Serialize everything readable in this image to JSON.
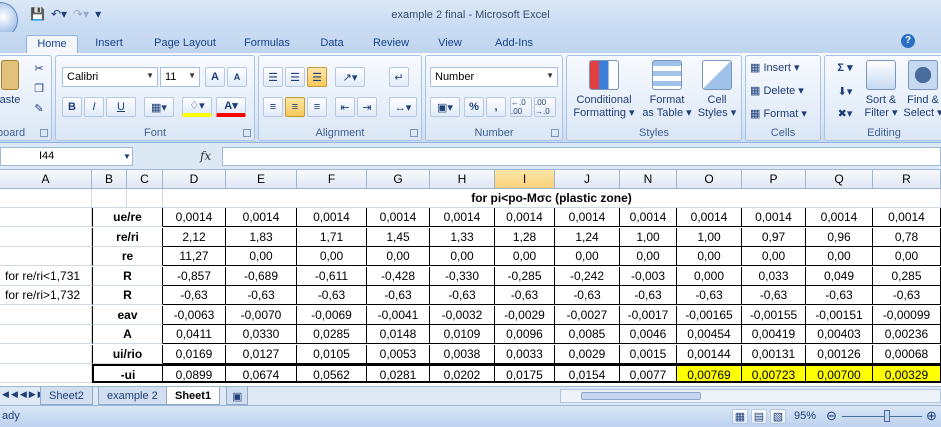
{
  "window": {
    "title": "example 2 final - Microsoft Excel"
  },
  "ribbon_tabs": [
    "Home",
    "Insert",
    "Page Layout",
    "Formulas",
    "Data",
    "Review",
    "View",
    "Add-Ins"
  ],
  "clipboard": {
    "paste": "aste",
    "label": "board"
  },
  "font": {
    "name": "Calibri",
    "size": "11",
    "bold": "B",
    "italic": "I",
    "underline": "U",
    "grow": "A",
    "shrink": "A",
    "color_letter": "A",
    "label": "Font"
  },
  "alignment": {
    "label": "Alignment"
  },
  "number": {
    "format": "Number",
    "percent": "%",
    "comma": ",",
    "inc": "←.0 .00",
    "dec": ".00 →.0",
    "label": "Number"
  },
  "styles": {
    "conditional": [
      "Conditional",
      "Formatting ▾"
    ],
    "format_table": [
      "Format",
      "as Table ▾"
    ],
    "cell_styles": [
      "Cell",
      "Styles ▾"
    ],
    "label": "Styles"
  },
  "cells": {
    "insert": "Insert ▾",
    "delete": "Delete ▾",
    "format": "Format ▾",
    "label": "Cells"
  },
  "editing": {
    "sigma": "Σ ▾",
    "sort": [
      "Sort &",
      "Filter ▾"
    ],
    "find": [
      "Find &",
      "Select ▾"
    ],
    "label": "Editing"
  },
  "formula_bar": {
    "name_box": "I44",
    "fx": "fx",
    "formula": ""
  },
  "columns": [
    "A",
    "B",
    "C",
    "D",
    "E",
    "F",
    "G",
    "H",
    "I",
    "J",
    "N",
    "O",
    "P",
    "Q",
    "R"
  ],
  "header_text": "for pi<po-Mσc (plastic zone)",
  "rows": [
    {
      "a": "",
      "label": "ue/re",
      "values": [
        "0,0014",
        "0,0014",
        "0,0014",
        "0,0014",
        "0,0014",
        "0,0014",
        "0,0014",
        "0,0014",
        "0,0014",
        "0,0014",
        "0,0014",
        "0,0014"
      ]
    },
    {
      "a": "",
      "label": "re/ri",
      "values": [
        "2,12",
        "1,83",
        "1,71",
        "1,45",
        "1,33",
        "1,28",
        "1,24",
        "1,00",
        "1,00",
        "0,97",
        "0,96",
        "0,78"
      ]
    },
    {
      "a": "",
      "label": "re",
      "values": [
        "11,27",
        "0,00",
        "0,00",
        "0,00",
        "0,00",
        "0,00",
        "0,00",
        "0,00",
        "0,00",
        "0,00",
        "0,00",
        "0,00"
      ]
    },
    {
      "a": "for re/ri<1,731",
      "label": "R",
      "values": [
        "-0,857",
        "-0,689",
        "-0,611",
        "-0,428",
        "-0,330",
        "-0,285",
        "-0,242",
        "-0,003",
        "0,000",
        "0,033",
        "0,049",
        "0,285"
      ]
    },
    {
      "a": "for re/ri>1,732",
      "label": "R",
      "values": [
        "-0,63",
        "-0,63",
        "-0,63",
        "-0,63",
        "-0,63",
        "-0,63",
        "-0,63",
        "-0,63",
        "-0,63",
        "-0,63",
        "-0,63",
        "-0,63"
      ]
    },
    {
      "a": "",
      "label": "eav",
      "values": [
        "-0,0063",
        "-0,0070",
        "-0,0069",
        "-0,0041",
        "-0,0032",
        "-0,0029",
        "-0,0027",
        "-0,0017",
        "-0,00165",
        "-0,00155",
        "-0,00151",
        "-0,00099"
      ]
    },
    {
      "a": "",
      "label": "A",
      "values": [
        "0,0411",
        "0,0330",
        "0,0285",
        "0,0148",
        "0,0109",
        "0,0096",
        "0,0085",
        "0,0046",
        "0,00454",
        "0,00419",
        "0,00403",
        "0,00236"
      ]
    },
    {
      "a": "",
      "label": "ui/rio",
      "values": [
        "0,0169",
        "0,0127",
        "0,0105",
        "0,0053",
        "0,0038",
        "0,0033",
        "0,0029",
        "0,0015",
        "0,00144",
        "0,00131",
        "0,00126",
        "0,00068"
      ]
    },
    {
      "a": "",
      "label": "-ui",
      "values": [
        "0,0899",
        "0,0674",
        "0,0562",
        "0,0281",
        "0,0202",
        "0,0175",
        "0,0154",
        "0,0077",
        "0,00769",
        "0,00723",
        "0,00700",
        "0,00329"
      ]
    }
  ],
  "sheet_tabs": [
    "Sheet2",
    "example 2",
    "Sheet1"
  ],
  "status": {
    "ready": "ady",
    "zoom": "95%"
  },
  "colors": {
    "highlight": "#ffff00",
    "ribbon": "#dbe8f7",
    "selected_col": "#f8d27a"
  }
}
